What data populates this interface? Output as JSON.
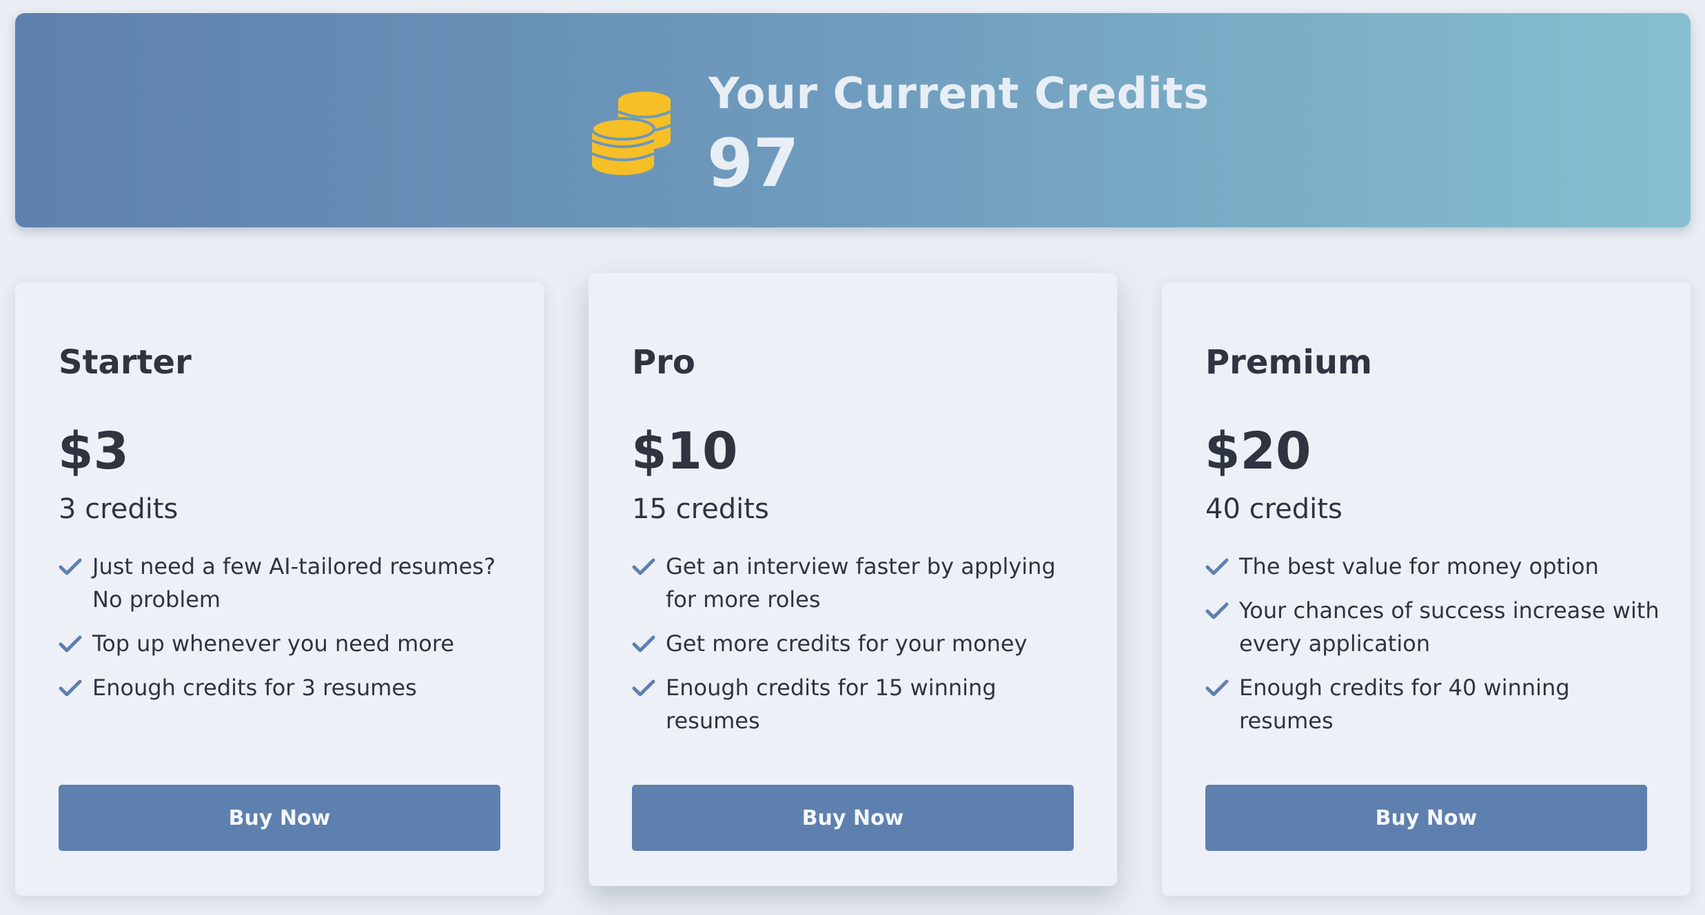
{
  "credits_banner": {
    "title": "Your Current Credits",
    "value": "97",
    "icon": "coins-icon",
    "icon_color": "#f7bf26"
  },
  "plans": [
    {
      "name": "Starter",
      "price": "$3",
      "credits": "3 credits",
      "features": [
        "Just need a few AI-tailored resumes? No problem",
        "Top up whenever you need more",
        "Enough credits for 3 resumes"
      ],
      "button_label": "Buy Now"
    },
    {
      "name": "Pro",
      "price": "$10",
      "credits": "15 credits",
      "features": [
        "Get an interview faster by applying for more roles",
        "Get more credits for your money",
        "Enough credits for 15 winning resumes"
      ],
      "button_label": "Buy Now"
    },
    {
      "name": "Premium",
      "price": "$20",
      "credits": "40 credits",
      "features": [
        "The best value for money option",
        "Your chances of success increase with every application",
        "Enough credits for 40 winning resumes"
      ],
      "button_label": "Buy Now"
    }
  ],
  "colors": {
    "accent": "#5e80ae",
    "check": "#5e80ae",
    "background": "#e9edf4",
    "card": "#edf0f7",
    "text": "#2e3440"
  }
}
